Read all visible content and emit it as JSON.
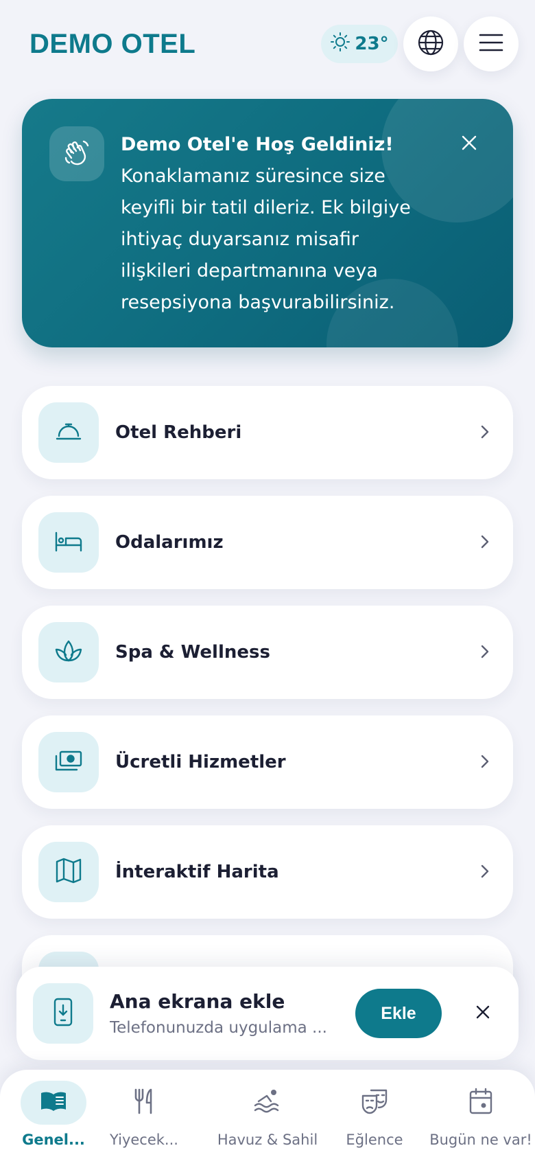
{
  "header": {
    "brand": "DEMO OTEL",
    "weather": {
      "icon": "sun-icon",
      "temperature": "23°"
    },
    "language_icon": "globe-icon",
    "menu_icon": "hamburger-menu-icon"
  },
  "welcome": {
    "icon": "waving-hand-icon",
    "title": "Demo Otel'e Hoş Geldiniz!",
    "message": "Konaklamanız süresince size keyifli bir tatil dileriz. Ek bilgiye ihtiyaç duyarsanız misafir ilişkileri departmanına veya resepsiyona başvurabilirsiniz."
  },
  "menu": [
    {
      "label": "Otel Rehberi",
      "icon": "service-bell-icon"
    },
    {
      "label": "Odalarımız",
      "icon": "bed-icon"
    },
    {
      "label": "Spa & Wellness",
      "icon": "lotus-icon"
    },
    {
      "label": "Ücretli Hizmetler",
      "icon": "money-icon"
    },
    {
      "label": "İnteraktif Harita",
      "icon": "map-icon"
    }
  ],
  "install_banner": {
    "icon": "phone-download-icon",
    "title": "Ana ekrana ekle",
    "subtitle": "Telefonunuzda uygulama ...",
    "button": "Ekle"
  },
  "tabs": [
    {
      "label": "Genel...",
      "icon": "book-icon",
      "active": true
    },
    {
      "label": "Yiyecek...",
      "icon": "fork-knife-icon",
      "active": false
    },
    {
      "label": "Havuz & Sahil",
      "icon": "swimmer-icon",
      "active": false
    },
    {
      "label": "Eğlence",
      "icon": "theater-masks-icon",
      "active": false
    },
    {
      "label": "Bugün ne var!",
      "icon": "calendar-icon",
      "active": false
    }
  ],
  "colors": {
    "accent": "#0e7a8c",
    "background": "#f2f3f9",
    "icon_tint_bg": "#dff1f5",
    "text_dark": "#1c1f33"
  }
}
